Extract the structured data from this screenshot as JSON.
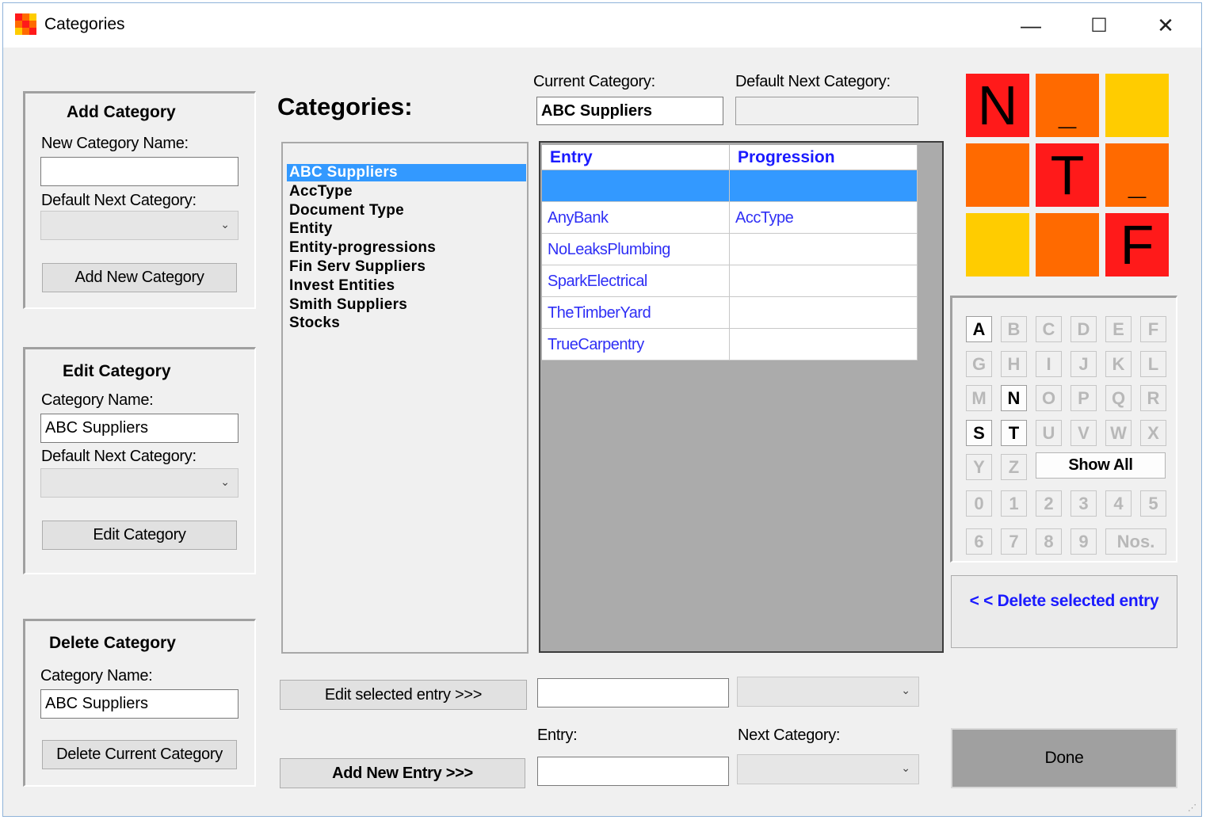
{
  "window": {
    "title": "Categories",
    "minimize": "—",
    "maximize": "☐",
    "close": "✕"
  },
  "add_category": {
    "title": "Add Category",
    "name_label": "New Category Name:",
    "name_value": "",
    "default_next_label": "Default Next Category:",
    "default_next_value": "",
    "button": "Add New Category"
  },
  "edit_category": {
    "title": "Edit Category",
    "name_label": "Category Name:",
    "name_value": "ABC Suppliers",
    "default_next_label": "Default Next Category:",
    "default_next_value": "",
    "button": "Edit Category"
  },
  "delete_category": {
    "title": "Delete Category",
    "name_label": "Category Name:",
    "name_value": "ABC Suppliers",
    "button": "Delete Current Category"
  },
  "categories": {
    "heading": "Categories:",
    "items": [
      "ABC Suppliers",
      "AccType",
      "Document Type",
      "Entity",
      "Entity-progressions",
      "Fin Serv Suppliers",
      "Invest Entities",
      "Smith Suppliers",
      "Stocks"
    ],
    "selected": "ABC Suppliers"
  },
  "current_category": {
    "label": "Current Category:",
    "value": "ABC Suppliers"
  },
  "default_next_category": {
    "label": "Default Next Category:",
    "value": ""
  },
  "grid": {
    "columns": [
      "Entry",
      "Progression"
    ],
    "rows": [
      [
        "",
        ""
      ],
      [
        "AnyBank",
        "AccType"
      ],
      [
        "NoLeaksPlumbing",
        ""
      ],
      [
        "SparkElectrical",
        ""
      ],
      [
        "TheTimberYard",
        ""
      ],
      [
        "TrueCarpentry",
        ""
      ]
    ]
  },
  "logo": {
    "cells": [
      {
        "char": "N",
        "color": "#ff1a1a"
      },
      {
        "char": "_",
        "color": "#ff6a00"
      },
      {
        "char": "",
        "color": "#ffcc00"
      },
      {
        "char": "",
        "color": "#ff6a00"
      },
      {
        "char": "T",
        "color": "#ff1a1a"
      },
      {
        "char": "_",
        "color": "#ff6a00"
      },
      {
        "char": "",
        "color": "#ffcc00"
      },
      {
        "char": "",
        "color": "#ff6a00"
      },
      {
        "char": "F",
        "color": "#ff1a1a"
      }
    ]
  },
  "filter": {
    "letters": [
      "A",
      "B",
      "C",
      "D",
      "E",
      "F",
      "G",
      "H",
      "I",
      "J",
      "K",
      "L",
      "M",
      "N",
      "O",
      "P",
      "Q",
      "R",
      "S",
      "T",
      "U",
      "V",
      "W",
      "X",
      "Y",
      "Z"
    ],
    "active_letters": [
      "A",
      "N",
      "S",
      "T"
    ],
    "show_all": "Show All",
    "digits": [
      "0",
      "1",
      "2",
      "3",
      "4",
      "5",
      "6",
      "7",
      "8",
      "9"
    ],
    "nos": "Nos."
  },
  "delete_entry_button": "< < Delete selected entry",
  "edit_entry_button": "Edit selected entry >>>",
  "edit_entry_value": "",
  "edit_next_value": "",
  "entry_label": "Entry:",
  "entry_value": "",
  "next_category_label": "Next Category:",
  "next_category_value": "",
  "add_entry_button": "Add New Entry >>>",
  "done_button": "Done",
  "colors": {
    "selection": "#3399ff",
    "grid_text": "#2f2ff5",
    "delete_entry_text": "#1a1aff"
  }
}
